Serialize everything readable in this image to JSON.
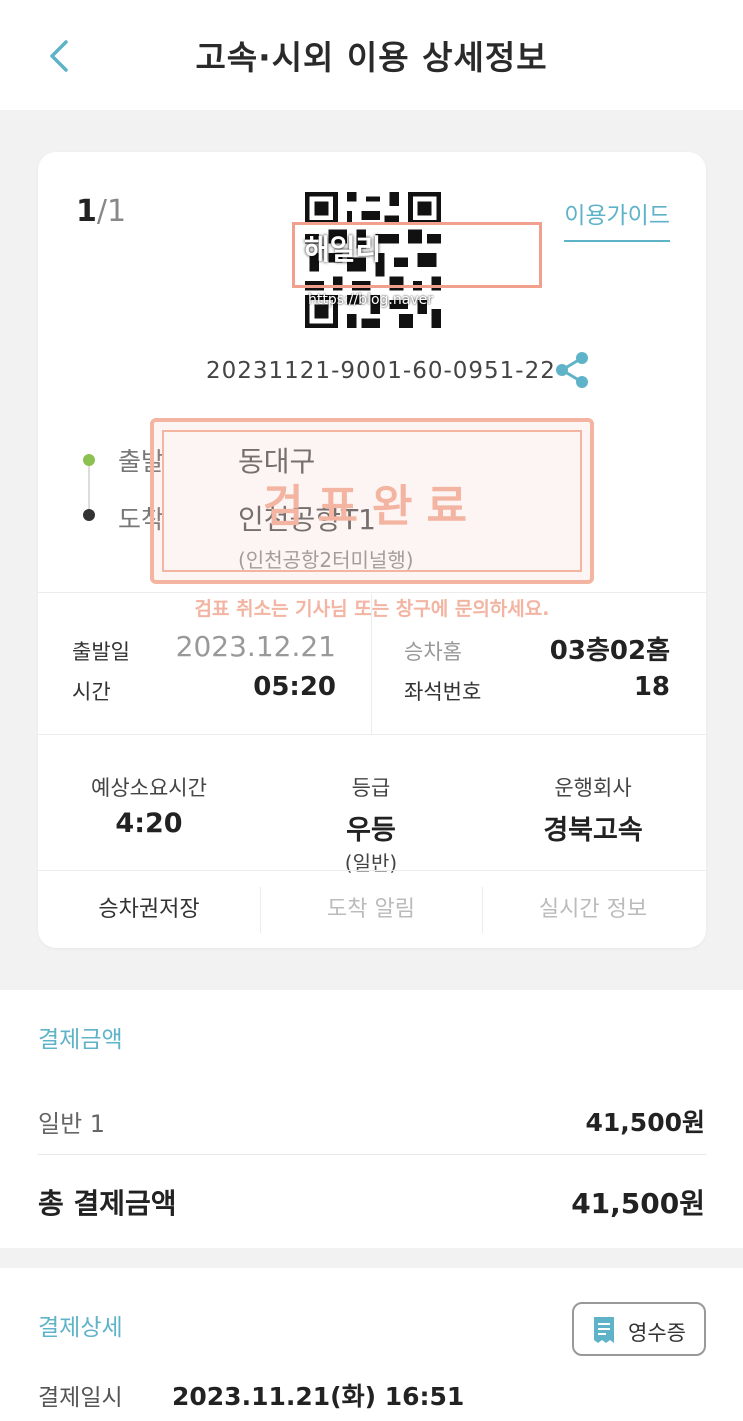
{
  "header": {
    "title": "고속·시외 이용 상세정보"
  },
  "ticket": {
    "page_current": "1",
    "page_sep": "/",
    "page_total": "1",
    "guide_label": "이용가이드",
    "qr_overlay_text": "해일리",
    "qr_overlay_sub": "https://blog.naver",
    "number": "20231121-9001-60-0951-22",
    "departure_label": "출발",
    "departure_value": "동대구",
    "arrival_label": "도착",
    "arrival_value": "인천공항T1",
    "arrival_sub": "(인천공항2터미널행)",
    "stamp_text": "검표완료",
    "stamp_note": "검표 취소는 기사님 또는 창구에 문의하세요.",
    "date_label": "출발일",
    "date_value": "2023.12.21",
    "time_label": "시간",
    "time_value": "05:20",
    "platform_label": "승차홈",
    "platform_value": "03층02홈",
    "seat_label": "좌석번호",
    "seat_value": "18",
    "duration_label": "예상소요시간",
    "duration_value": "4:20",
    "grade_label": "등급",
    "grade_value": "우등",
    "grade_sub": "(일반)",
    "company_label": "운행회사",
    "company_value": "경북고속",
    "actions": [
      "승차권저장",
      "도착 알림",
      "실시간 정보"
    ]
  },
  "payment": {
    "title": "결제금액",
    "row_label": "일반 1",
    "row_value": "41,500원",
    "total_label": "총 결제금액",
    "total_value": "41,500원"
  },
  "detail": {
    "title": "결제상세",
    "receipt_label": "영수증",
    "datetime_label": "결제일시",
    "datetime_value": "2023.11.21(화) 16:51"
  },
  "colors": {
    "accent": "#5fb3c9",
    "stamp": "#f3b4a2",
    "depart_dot": "#8cc152"
  }
}
